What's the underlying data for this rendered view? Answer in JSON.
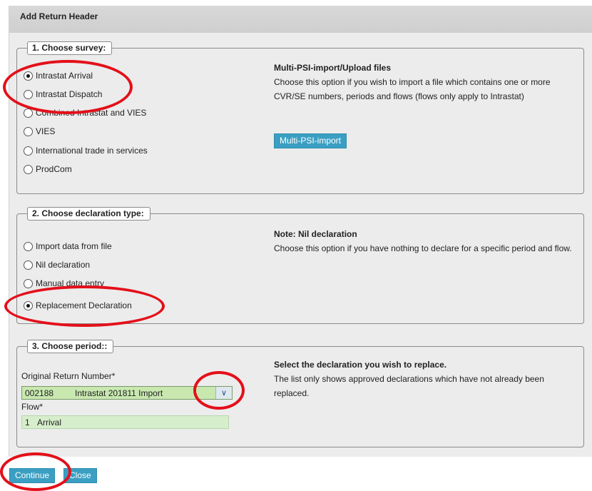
{
  "header": {
    "title": "Add Return Header"
  },
  "survey": {
    "legend": "1. Choose survey:",
    "options": [
      {
        "label": "Intrastat Arrival",
        "checked": true
      },
      {
        "label": "Intrastat Dispatch",
        "checked": false
      },
      {
        "label": "Combined Intrastat and VIES",
        "checked": false
      },
      {
        "label": "VIES",
        "checked": false
      },
      {
        "label": "International trade in services",
        "checked": false
      },
      {
        "label": "ProdCom",
        "checked": false
      }
    ],
    "info_title": "Multi-PSI-import/Upload files",
    "info_text": "Choose this option if you wish to import a file which contains one or more CVR/SE numbers, periods and flows (flows only apply to Intrastat)",
    "button_label": "Multi-PSI-import"
  },
  "declaration": {
    "legend": "2. Choose declaration type:",
    "options": [
      {
        "label": "Import data from file",
        "checked": false
      },
      {
        "label": "Nil declaration",
        "checked": false
      },
      {
        "label": "Manual data entry",
        "checked": false
      },
      {
        "label": "Replacement Declaration",
        "checked": true
      }
    ],
    "info_title": "Note: Nil declaration",
    "info_text": "Choose this option if you have nothing to declare for a specific period and flow."
  },
  "period": {
    "legend": "3. Choose period::",
    "return_label": "Original Return Number*",
    "return_code": "002188",
    "return_text": "Intrastat 201811 Import",
    "flow_label": "Flow*",
    "flow_code": "1",
    "flow_text": "Arrival",
    "info_title": "Select the declaration you wish to replace.",
    "info_text": "The list only shows approved declarations which have not already been replaced."
  },
  "footer": {
    "continue_label": "Continue",
    "close_label": "Close"
  },
  "colors": {
    "annotation": "#e3101a",
    "button": "#3a9fc2",
    "select_fill": "#c8e8b0"
  }
}
